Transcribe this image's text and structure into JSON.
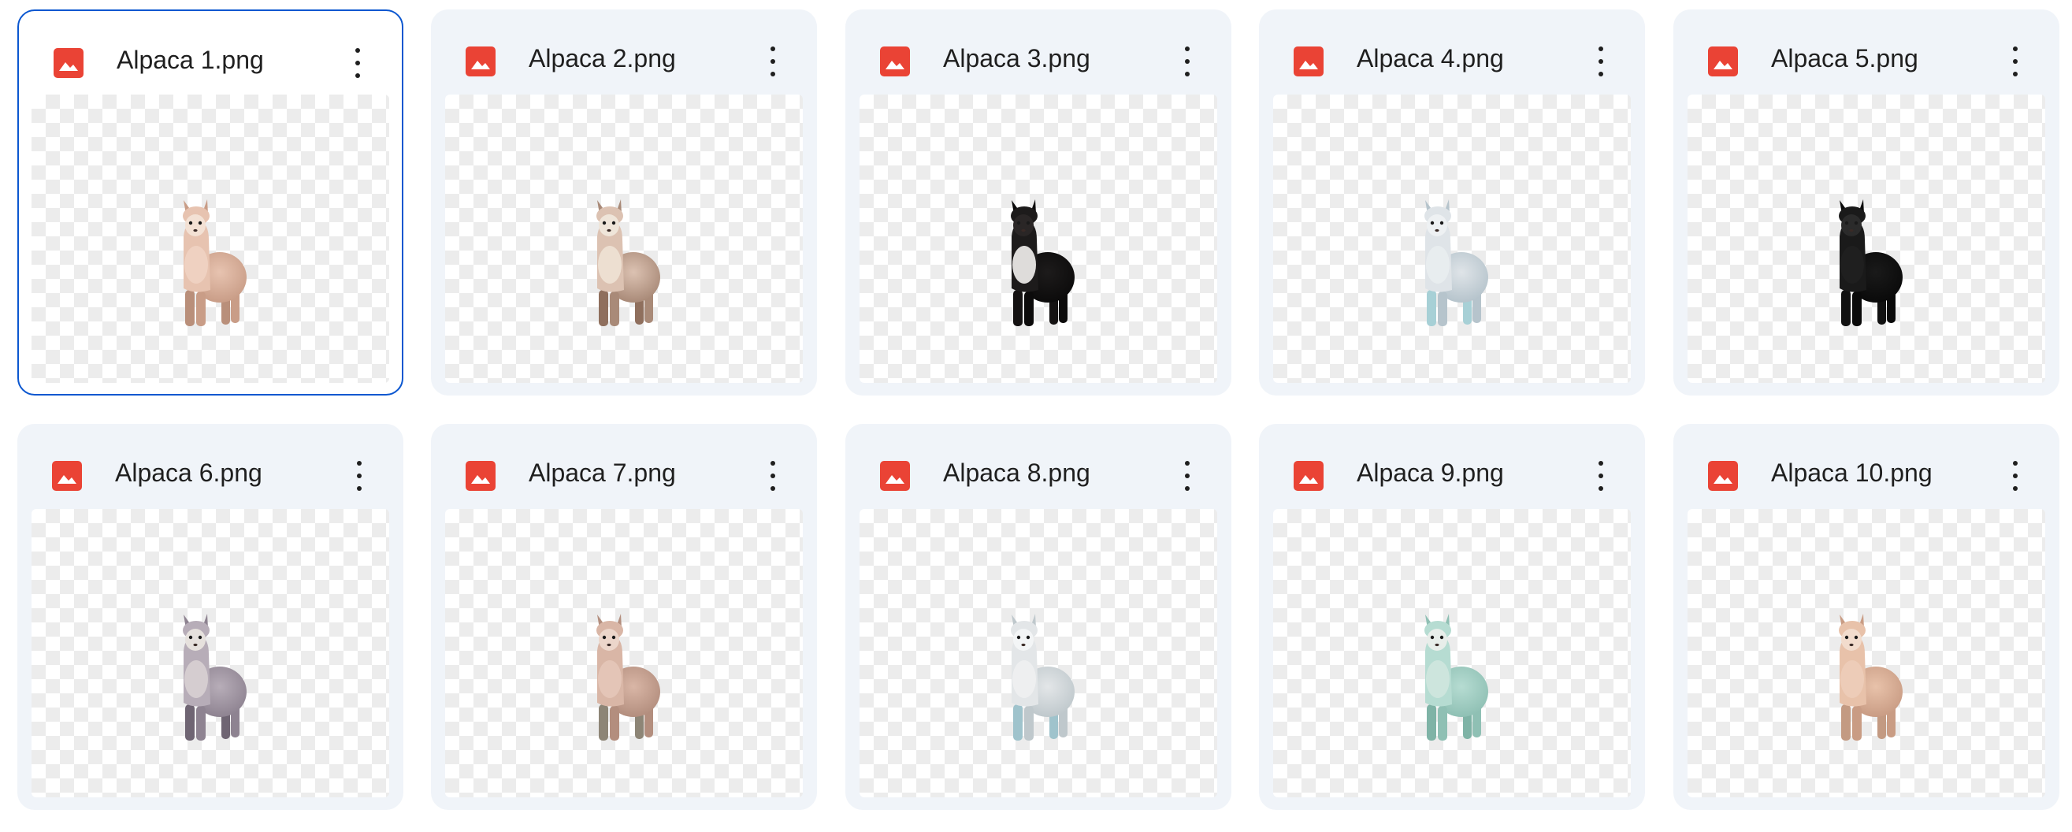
{
  "files": [
    {
      "name": "Alpaca 1.png",
      "selected": true,
      "icon": "image-file-icon",
      "alpaca": {
        "body": "#e7c3b0",
        "shade": "#c99d87",
        "legs": "#b98f7a",
        "face": "#f3e1d4",
        "bib": "#efd3c3"
      }
    },
    {
      "name": "Alpaca 2.png",
      "selected": false,
      "icon": "image-file-icon",
      "alpaca": {
        "body": "#dcc2b2",
        "shade": "#a98a78",
        "legs": "#8f6f5d",
        "face": "#efe5d9",
        "bib": "#eee2d4"
      }
    },
    {
      "name": "Alpaca 3.png",
      "selected": false,
      "icon": "image-file-icon",
      "alpaca": {
        "body": "#1d1b1b",
        "shade": "#0c0b0b",
        "legs": "#141212",
        "face": "#2a2626",
        "bib": "#f4f2f0"
      }
    },
    {
      "name": "Alpaca 4.png",
      "selected": false,
      "icon": "image-file-icon",
      "alpaca": {
        "body": "#dfe4e8",
        "shade": "#b6c4cc",
        "legs": "#a7d0d6",
        "face": "#eef1f3",
        "bib": "#e9edf0"
      }
    },
    {
      "name": "Alpaca 5.png",
      "selected": false,
      "icon": "image-file-icon",
      "alpaca": {
        "body": "#1a1a1a",
        "shade": "#0a0a0a",
        "legs": "#111111",
        "face": "#2b2b2b",
        "bib": "#202020"
      }
    },
    {
      "name": "Alpaca 6.png",
      "selected": false,
      "icon": "image-file-icon",
      "alpaca": {
        "body": "#b7adb8",
        "shade": "#8e8391",
        "legs": "#6f6573",
        "face": "#e6e1dd",
        "bib": "#d8d0d3"
      }
    },
    {
      "name": "Alpaca 7.png",
      "selected": false,
      "icon": "image-file-icon",
      "alpaca": {
        "body": "#d9b6a6",
        "shade": "#b38e7e",
        "legs": "#8d8576",
        "face": "#ecd6ca",
        "bib": "#e4c7b9"
      }
    },
    {
      "name": "Alpaca 8.png",
      "selected": false,
      "icon": "image-file-icon",
      "alpaca": {
        "body": "#e3e6e8",
        "shade": "#bfc8cc",
        "legs": "#9fc3cc",
        "face": "#f3f5f6",
        "bib": "#eef0f1"
      }
    },
    {
      "name": "Alpaca 9.png",
      "selected": false,
      "icon": "image-file-icon",
      "alpaca": {
        "body": "#b6dcd2",
        "shade": "#8fc0b4",
        "legs": "#7fb3a6",
        "face": "#e8eeea",
        "bib": "#cfe6de"
      }
    },
    {
      "name": "Alpaca 10.png",
      "selected": false,
      "icon": "image-file-icon",
      "alpaca": {
        "body": "#e8c2aa",
        "shade": "#c99c84",
        "legs": "#c39a82",
        "face": "#f2dccd",
        "bib": "#edcdb9"
      }
    }
  ],
  "colors": {
    "card_bg": "#f0f4f9",
    "selected_border": "#0b57d0",
    "icon_red": "#ea4335",
    "text": "#1f1f1f"
  }
}
